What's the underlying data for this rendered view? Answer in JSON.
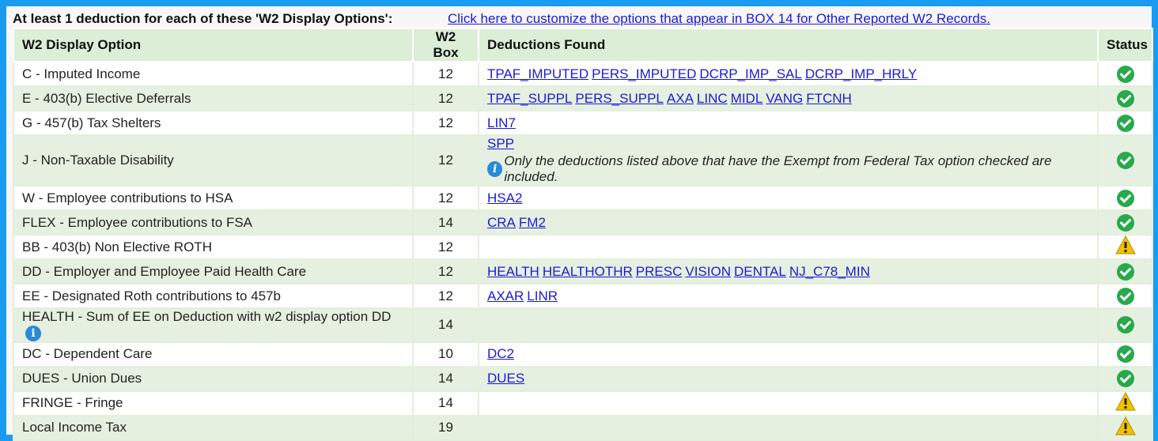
{
  "header": {
    "title": "At least 1 deduction for each of these 'W2 Display Options':",
    "link": "Click here to customize the options that appear in BOX 14 for Other Reported W2 Records."
  },
  "columns": {
    "option": "W2 Display Option",
    "box": "W2 Box",
    "deductions": "Deductions Found",
    "status": "Status"
  },
  "rows": [
    {
      "option": "C - Imputed Income",
      "box": "12",
      "deductions": [
        "TPAF_IMPUTED",
        "PERS_IMPUTED",
        "DCRP_IMP_SAL",
        "DCRP_IMP_HRLY"
      ],
      "status": "ok"
    },
    {
      "option": "E - 403(b) Elective Deferrals",
      "box": "12",
      "deductions": [
        "TPAF_SUPPL",
        "PERS_SUPPL",
        "AXA",
        "LINC",
        "MIDL",
        "VANG",
        "FTCNH"
      ],
      "status": "ok"
    },
    {
      "option": "G - 457(b) Tax Shelters",
      "box": "12",
      "deductions": [
        "LIN7"
      ],
      "status": "ok"
    },
    {
      "option": "J - Non-Taxable Disability",
      "box": "12",
      "deductions": [
        "SPP"
      ],
      "note": "Only the deductions listed above that have the Exempt from Federal Tax option checked are included.",
      "status": "ok"
    },
    {
      "option": "W - Employee contributions to HSA",
      "box": "12",
      "deductions": [
        "HSA2"
      ],
      "status": "ok"
    },
    {
      "option": "FLEX - Employee contributions to FSA",
      "box": "14",
      "deductions": [
        "CRA",
        "FM2"
      ],
      "status": "ok"
    },
    {
      "option": "BB - 403(b) Non Elective ROTH",
      "box": "12",
      "deductions": [],
      "status": "warning"
    },
    {
      "option": "DD - Employer and Employee Paid Health Care",
      "box": "12",
      "deductions": [
        "HEALTH",
        "HEALTHOTHR",
        "PRESC",
        "VISION",
        "DENTAL",
        "NJ_C78_MIN"
      ],
      "status": "ok"
    },
    {
      "option": "EE - Designated Roth contributions to 457b",
      "box": "12",
      "deductions": [
        "AXAR",
        "LINR"
      ],
      "status": "ok"
    },
    {
      "option": "HEALTH - Sum of EE on Deduction with w2 display option DD",
      "box": "14",
      "deductions": [],
      "info_icon": true,
      "status": "ok"
    },
    {
      "option": "DC - Dependent Care",
      "box": "10",
      "deductions": [
        "DC2"
      ],
      "status": "ok"
    },
    {
      "option": "DUES - Union Dues",
      "box": "14",
      "deductions": [
        "DUES"
      ],
      "status": "ok"
    },
    {
      "option": "FRINGE - Fringe",
      "box": "14",
      "deductions": [],
      "status": "warning"
    },
    {
      "option": "Local Income Tax",
      "box": "19",
      "deductions": [],
      "status": "warning"
    }
  ],
  "colors": {
    "accent": "#1a9bf0",
    "ok": "#27a94c",
    "warning": "#f2c200",
    "link": "#1a1ad6"
  }
}
